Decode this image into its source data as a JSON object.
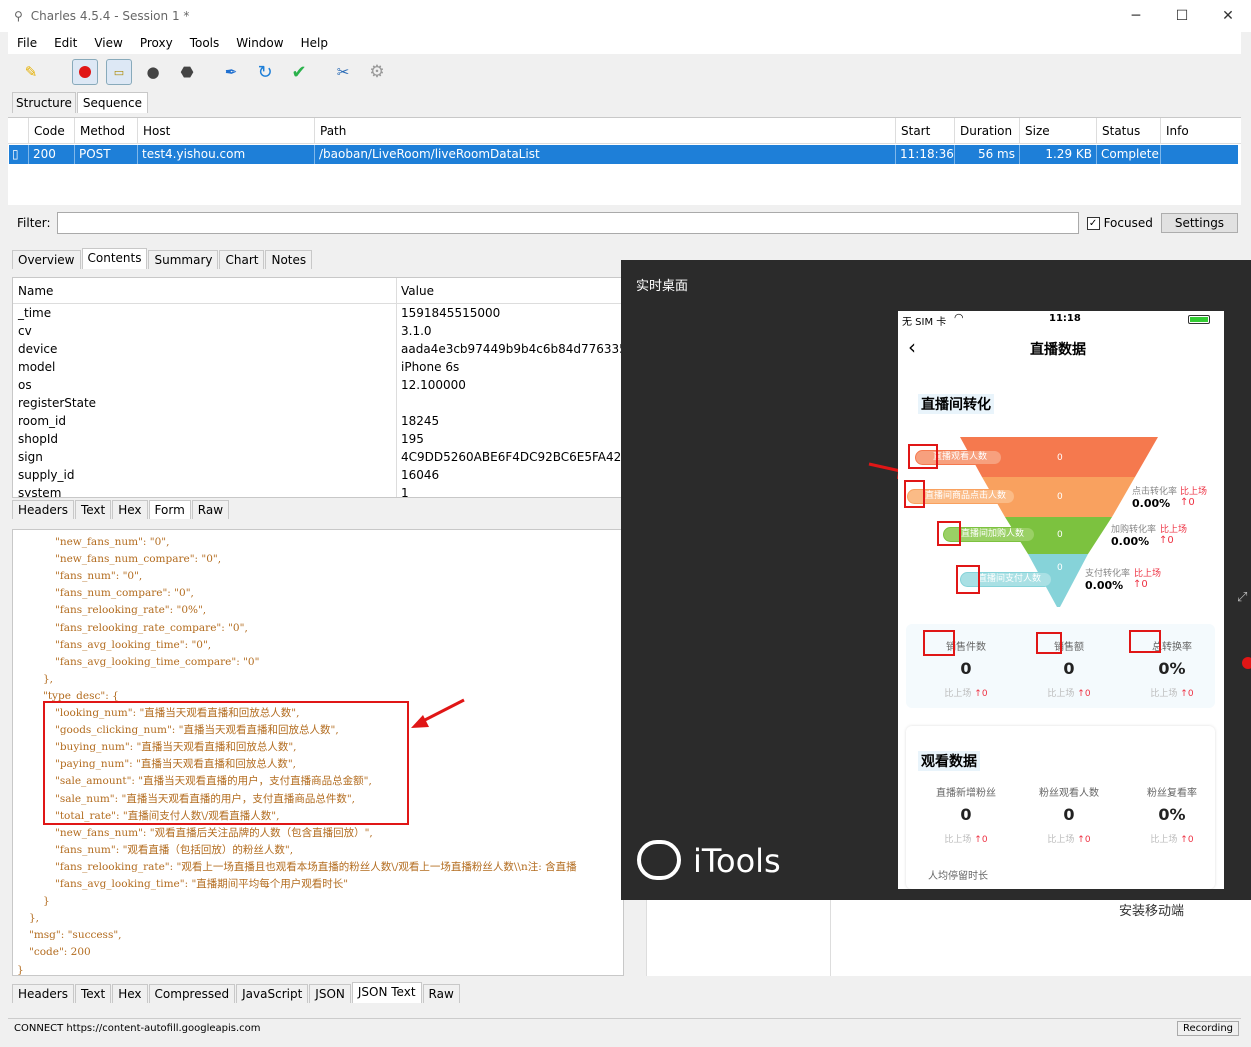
{
  "window": {
    "title": "Charles 4.5.4 - Session 1 *"
  },
  "menu": [
    "File",
    "Edit",
    "View",
    "Proxy",
    "Tools",
    "Window",
    "Help"
  ],
  "top_tabs": [
    "Structure",
    "Sequence"
  ],
  "seq_columns": [
    "Code",
    "Method",
    "Host",
    "Path",
    "Start",
    "Duration",
    "Size",
    "Status",
    "Info"
  ],
  "seq_row": {
    "code": "200",
    "method": "POST",
    "host": "test4.yishou.com",
    "path": "/baoban/LiveRoom/liveRoomDataList",
    "start": "11:18:36",
    "duration": "56 ms",
    "size": "1.29 KB",
    "status": "Complete",
    "info": ""
  },
  "filter": {
    "label": "Filter:",
    "focused_label": "Focused",
    "settings_label": "Settings",
    "value": ""
  },
  "content_tabs": [
    "Overview",
    "Contents",
    "Summary",
    "Chart",
    "Notes"
  ],
  "nv_header": {
    "name": "Name",
    "value": "Value"
  },
  "nv_rows": [
    {
      "name": "_time",
      "value": "1591845515000"
    },
    {
      "name": "cv",
      "value": "3.1.0"
    },
    {
      "name": "device",
      "value": "aada4e3cb97449b9b4c6b84d776335b"
    },
    {
      "name": "model",
      "value": "iPhone 6s"
    },
    {
      "name": "os",
      "value": "12.100000"
    },
    {
      "name": "registerState",
      "value": ""
    },
    {
      "name": "room_id",
      "value": "18245"
    },
    {
      "name": "shopId",
      "value": "195"
    },
    {
      "name": "sign",
      "value": "4C9DD5260ABE6F4DC92BC6E5FA421D"
    },
    {
      "name": "supply_id",
      "value": "16046"
    },
    {
      "name": "system",
      "value": "1"
    }
  ],
  "request_tabs": [
    "Headers",
    "Text",
    "Hex",
    "Form",
    "Raw"
  ],
  "json_lines": [
    "\"new_fans_num\": \"0\",",
    "\"new_fans_num_compare\": \"0\",",
    "\"fans_num\": \"0\",",
    "\"fans_num_compare\": \"0\",",
    "\"fans_relooking_rate\": \"0%\",",
    "\"fans_relooking_rate_compare\": \"0\",",
    "\"fans_avg_looking_time\": \"0\",",
    "\"fans_avg_looking_time_compare\": \"0\"",
    "},",
    "\"type_desc\": {",
    "\"looking_num\": \"直播当天观看直播和回放总人数\",",
    "\"goods_clicking_num\": \"直播当天观看直播和回放总人数\",",
    "\"buying_num\": \"直播当天观看直播和回放总人数\",",
    "\"paying_num\": \"直播当天观看直播和回放总人数\",",
    "\"sale_amount\": \"直播当天观看直播的用户，支付直播商品总金额\",",
    "\"sale_num\": \"直播当天观看直播的用户，支付直播商品总件数\",",
    "\"total_rate\": \"直播间支付人数\\/观看直播人数\",",
    "\"new_fans_num\": \"观看直播后关注品牌的人数（包含直播回放）\",",
    "\"fans_num\": \"观看直播（包括回放）的粉丝人数\",",
    "\"fans_relooking_rate\": \"观看上一场直播且也观看本场直播的粉丝人数\\/观看上一场直播粉丝人数\\\\n注: 含直播",
    "\"fans_avg_looking_time\": \"直播期间平均每个用户观看时长\"",
    "}",
    "},",
    "\"msg\": \"success\",",
    "\"code\": 200",
    "}"
  ],
  "response_tabs": [
    "Headers",
    "Text",
    "Hex",
    "Compressed",
    "JavaScript",
    "JSON",
    "JSON Text",
    "Raw"
  ],
  "status": {
    "left": "CONNECT https://content-autofill.googleapis.com",
    "right": "Recording"
  },
  "itools": {
    "title": "实时桌面",
    "logo": "iTools"
  },
  "phone": {
    "carrier": "无 SIM 卡",
    "time": "11:18",
    "page_title": "直播数据",
    "section1": "直播间转化",
    "funnel": [
      {
        "label": "直播观看人数",
        "value": "0"
      },
      {
        "label": "直播间商品点击人数",
        "value": "0"
      },
      {
        "label": "直播间加购人数",
        "value": "0"
      },
      {
        "label": "直播间支付人数",
        "value": "0"
      }
    ],
    "rates": [
      {
        "label": "点击转化率",
        "cmp": "比上场",
        "value": "0.00%",
        "delta": "↑0"
      },
      {
        "label": "加购转化率",
        "cmp": "比上场",
        "value": "0.00%",
        "delta": "↑0"
      },
      {
        "label": "支付转化率",
        "cmp": "比上场",
        "value": "0.00%",
        "delta": "↑0"
      }
    ],
    "metrics": [
      {
        "label": "销售件数",
        "value": "0",
        "cmp": "比上场",
        "delta": "↑0"
      },
      {
        "label": "销售额",
        "value": "0",
        "cmp": "比上场",
        "delta": "↑0"
      },
      {
        "label": "总转换率",
        "value": "0%",
        "cmp": "比上场",
        "delta": "↑0"
      }
    ],
    "section2": "观看数据",
    "metrics2": [
      {
        "label": "直播新增粉丝",
        "value": "0",
        "cmp": "比上场",
        "delta": "↑0"
      },
      {
        "label": "粉丝观看人数",
        "value": "0",
        "cmp": "比上场",
        "delta": "↑0"
      },
      {
        "label": "粉丝复看率",
        "value": "0%",
        "cmp": "比上场",
        "delta": "↑0"
      }
    ],
    "avg_stay": "人均停留时长"
  },
  "behind_text": "安装移动端",
  "colors": {
    "selection": "#1e7fd8",
    "funnel": [
      "#f5794e",
      "#f9a15f",
      "#7cc23f",
      "#86d3d9"
    ],
    "accent_red": "#e01616"
  }
}
